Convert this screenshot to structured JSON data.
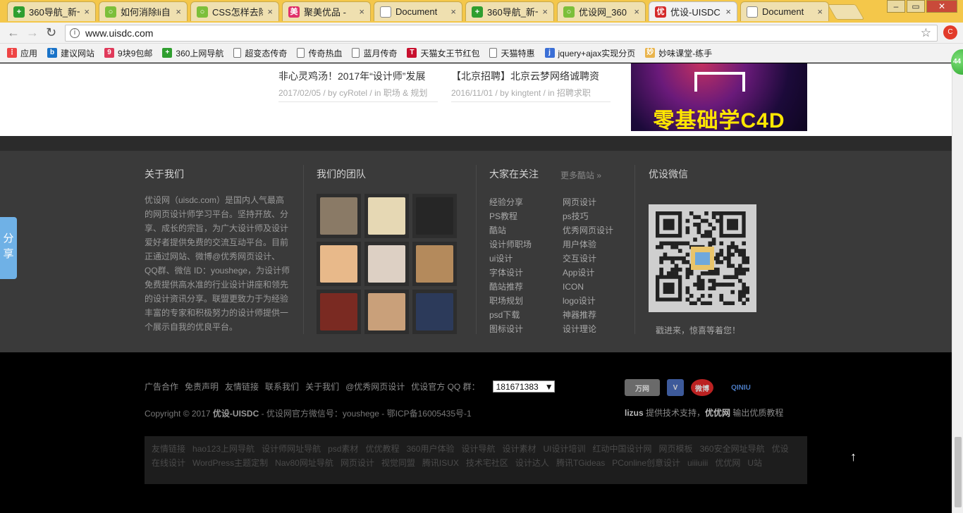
{
  "browser": {
    "tabs": [
      {
        "title": "360导航_新一",
        "icon": "360-icon",
        "color": "#2f9e2f",
        "glyph": "+"
      },
      {
        "title": "如何消除li自",
        "icon": "loading-ring-icon",
        "color": "#7cbf3a",
        "glyph": "○"
      },
      {
        "title": "CSS怎样去除",
        "icon": "loading-ring-icon",
        "color": "#7cbf3a",
        "glyph": "○"
      },
      {
        "title": "聚美优品 -",
        "icon": "jumei-icon",
        "color": "#e0306a",
        "glyph": "美"
      },
      {
        "title": "Document",
        "icon": "document-icon",
        "color": "#ffffff",
        "glyph": ""
      },
      {
        "title": "360导航_新一",
        "icon": "360-icon",
        "color": "#2f9e2f",
        "glyph": "+"
      },
      {
        "title": "优设网_360",
        "icon": "loading-ring-icon",
        "color": "#7cbf3a",
        "glyph": "○"
      },
      {
        "title": "优设-UISDC",
        "icon": "uisdc-icon",
        "color": "#d42a2a",
        "glyph": "优",
        "active": true
      },
      {
        "title": "Document",
        "icon": "document-icon",
        "color": "#ffffff",
        "glyph": ""
      }
    ],
    "url": "www.uisdc.com",
    "bookmarks": [
      {
        "label": "应用",
        "icon": "apps-grid-icon",
        "color": "#e44",
        "glyph": "⋮"
      },
      {
        "label": "建议网站",
        "icon": "bing-icon",
        "color": "#1a73c8",
        "glyph": "b"
      },
      {
        "label": "9块9包邮",
        "icon": "tag-icon",
        "color": "#e03a5a",
        "glyph": "9"
      },
      {
        "label": "360上网导航",
        "icon": "360-icon",
        "color": "#2f9e2f",
        "glyph": "+"
      },
      {
        "label": "超变态传奇",
        "icon": "page-icon",
        "color": "#ffffff",
        "glyph": ""
      },
      {
        "label": "传奇热血",
        "icon": "page-icon",
        "color": "#ffffff",
        "glyph": ""
      },
      {
        "label": "蓝月传奇",
        "icon": "page-icon",
        "color": "#ffffff",
        "glyph": ""
      },
      {
        "label": "天猫女王节红包",
        "icon": "tmall-icon",
        "color": "#c8102e",
        "glyph": "T"
      },
      {
        "label": "天猫特惠",
        "icon": "page-icon",
        "color": "#ffffff",
        "glyph": ""
      },
      {
        "label": "jquery+ajax实现分页",
        "icon": "jquery-icon",
        "color": "#3b6fd6",
        "glyph": "j"
      },
      {
        "label": "妙味课堂-练手",
        "icon": "miaov-icon",
        "color": "#e9b44c",
        "glyph": "妙"
      }
    ]
  },
  "articles": [
    {
      "title": "非心灵鸡汤！2017年“设计师”发展",
      "meta": "2017/02/05 / by cyRotel / in 职场 & 规划"
    },
    {
      "title": "【北京招聘】北京云梦网络诚聘资",
      "meta": "2016/11/01 / by kingtent / in 招聘求职"
    }
  ],
  "banner": {
    "text": "零基础学C4D"
  },
  "footer": {
    "about": {
      "title": "关于我们",
      "text": "优设网（uisdc.com）是国内人气最高的网页设计师学习平台。坚持开放、分享、成长的宗旨，为广大设计师及设计爱好者提供免费的交流互动平台。目前正通过网站、微博@优秀网页设计、QQ群、微信 ID：youshege，为设计师免费提供高水准的行业设计讲座和领先的设计资讯分享。联盟更致力于为经验丰富的专家和积极努力的设计师提供一个展示自我的优良平台。"
    },
    "team": {
      "title": "我们的团队",
      "members": [
        "#8a7a66",
        "#e6d8b4",
        "#262626",
        "#e8b98a",
        "#ddd0c4",
        "#b48a5c",
        "#7a2a22",
        "#c9a07a",
        "#2c3a5a"
      ]
    },
    "focus": {
      "title": "大家在关注",
      "more": "更多酷站 »",
      "col1": [
        "经验分享",
        "PS教程",
        "酷站",
        "设计师职场",
        "ui设计",
        "字体设计",
        "酷站推荐",
        "职场规划",
        "psd下载",
        "图标设计"
      ],
      "col2": [
        "网页设计",
        "ps技巧",
        "优秀网页设计",
        "用户体验",
        "交互设计",
        "App设计",
        "ICON",
        "logo设计",
        "神器推荐",
        "设计理论"
      ]
    },
    "wechat": {
      "title": "优设微信",
      "tip": "戳进来，惊喜等着您！"
    }
  },
  "bottom": {
    "links": [
      "广告合作",
      "免责声明",
      "友情链接",
      "联系我们",
      "关于我们",
      "@优秀网页设计",
      "优设官方 QQ 群："
    ],
    "qq_value": "181671383",
    "copyright_prefix": "Copyright © 2017",
    "copyright_brand": "优设-UISDC",
    "copyright_suffix": "- 优设网官方微信号：youshege - 鄂ICP备16005435号-1",
    "logos": [
      "万网",
      "V",
      "微博",
      "QINIU"
    ],
    "credit_a": "lizus",
    "credit_b": "提供技术支持，",
    "credit_c": "优优网",
    "credit_d": "输出优质教程",
    "friend_links": [
      "友情链接",
      "hao123上网导航",
      "设计师网址导航",
      "psd素材",
      "优优教程",
      "360用户体验",
      "设计导航",
      "设计素材",
      "UI设计培训",
      "红动中国设计网",
      "网页模板",
      "360安全网址导航",
      "优设",
      "在线设计",
      "WordPress主题定制",
      "Nav80网址导航",
      "网页设计",
      "视觉同盟",
      "腾讯ISUX",
      "技术宅社区",
      "设计达人",
      "腾讯TGideas",
      "PConline创意设计",
      "uiiiuiii",
      "优优网",
      "U站"
    ],
    "totop": "↑"
  },
  "share": {
    "label": "分享"
  },
  "side_badge": "44"
}
